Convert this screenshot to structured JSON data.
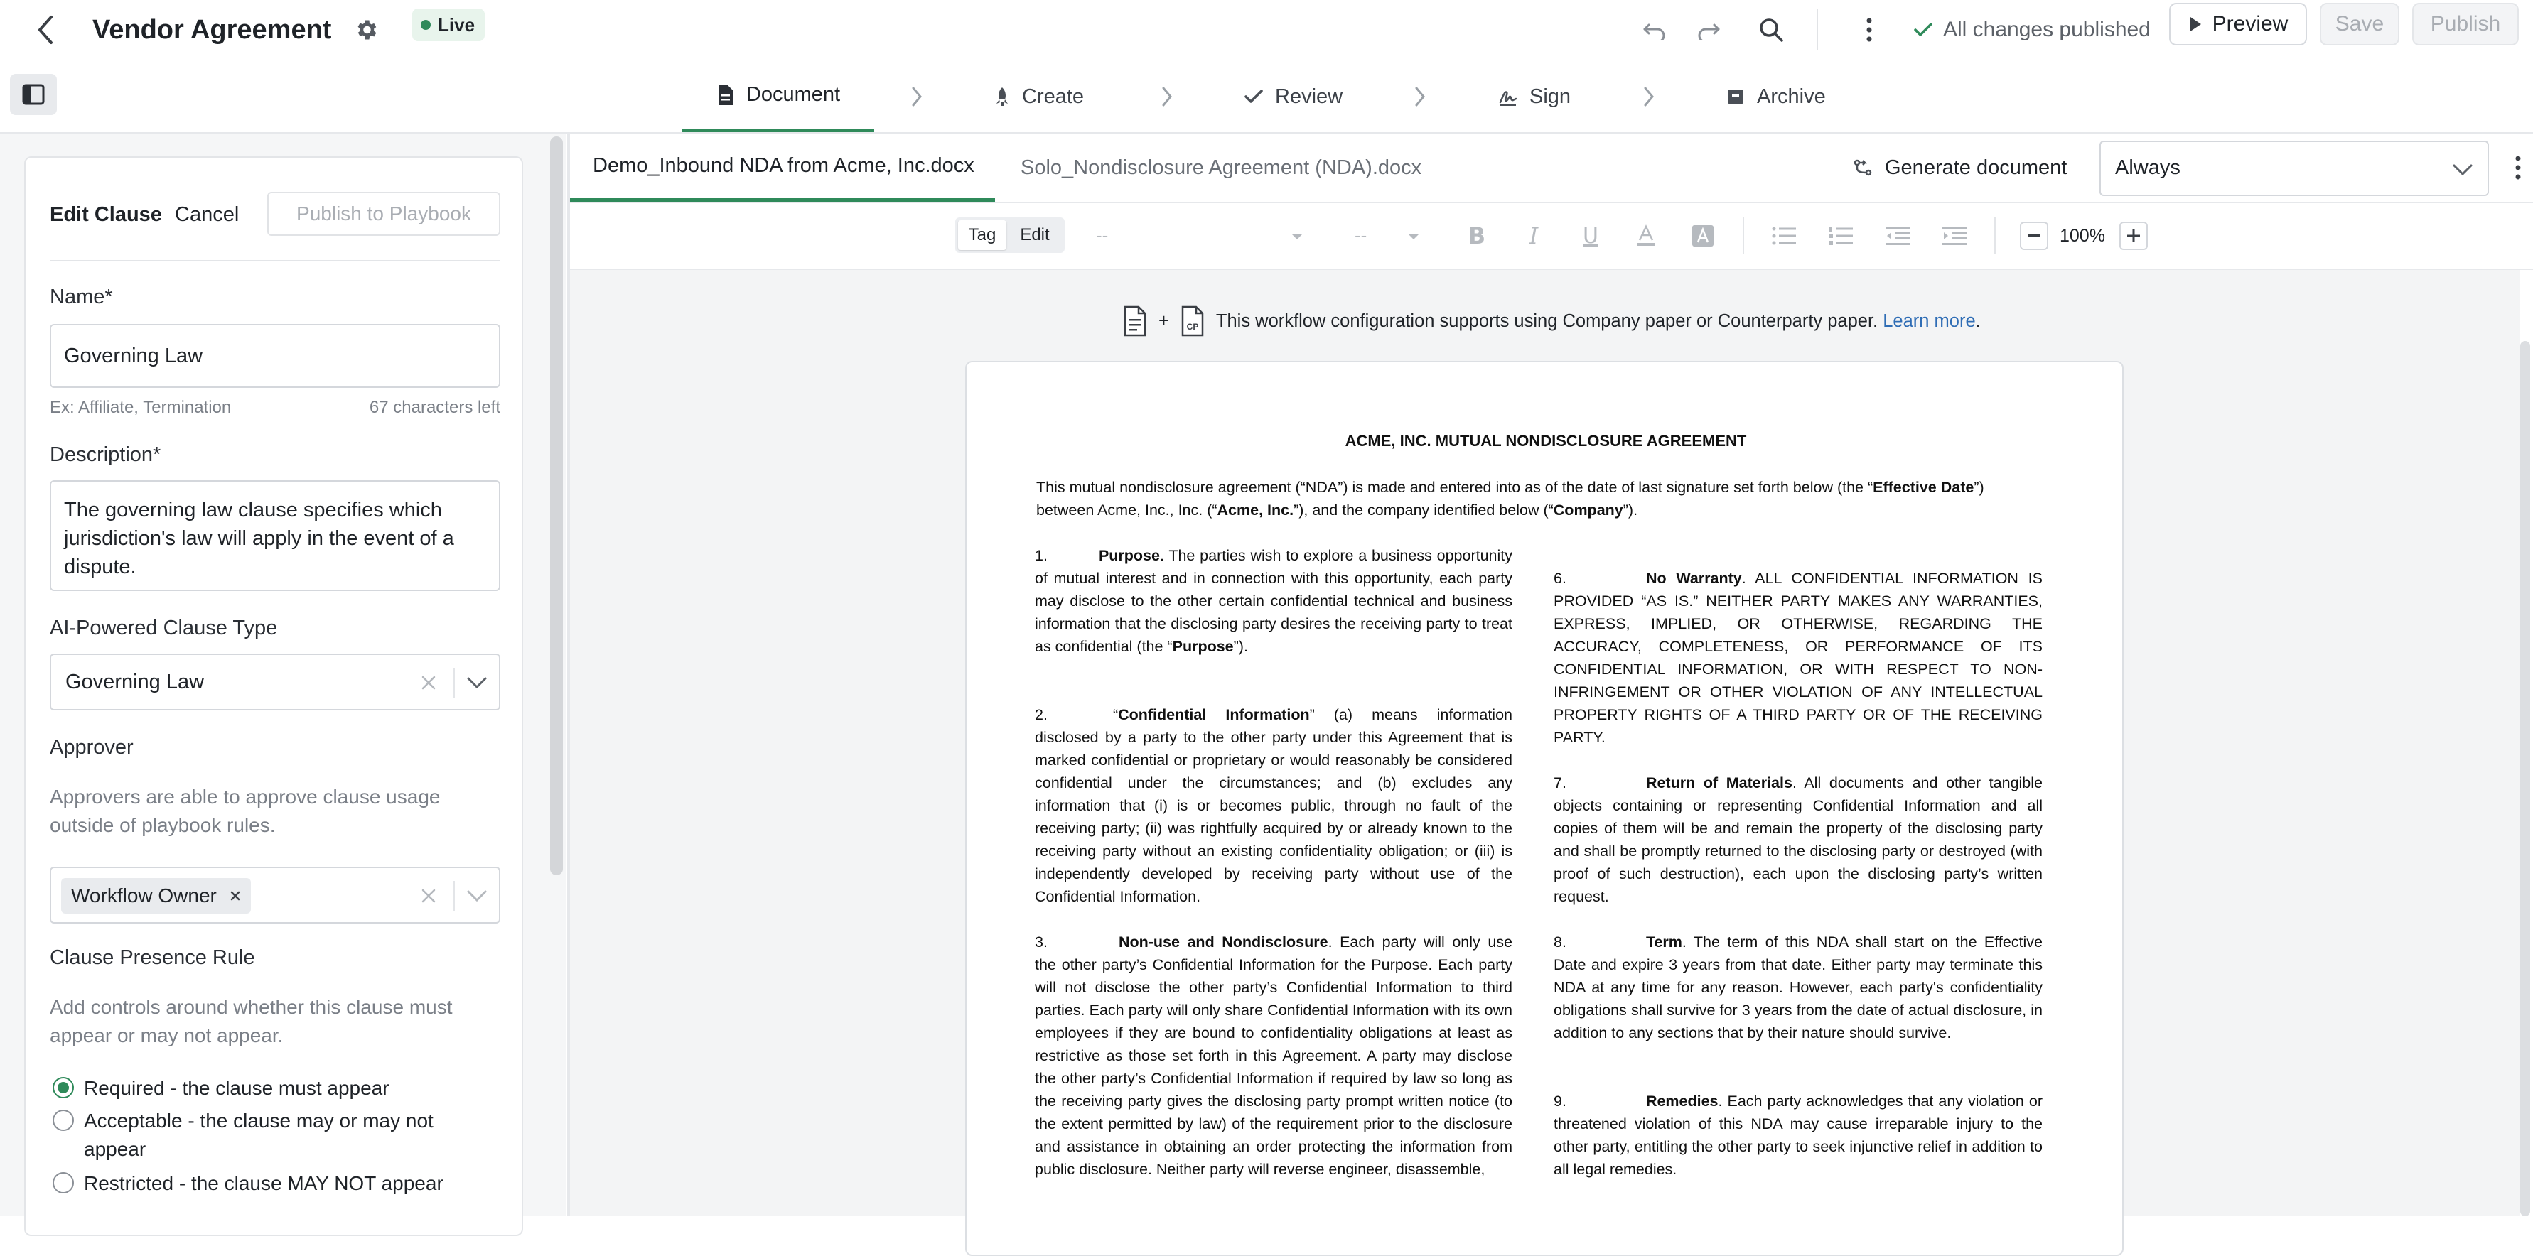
{
  "header": {
    "title": "Vendor Agreement",
    "status_badge": "Live",
    "publish_status": "All changes published",
    "preview_label": "Preview",
    "save_label": "Save",
    "publish_label": "Publish"
  },
  "steps": [
    {
      "label": "Document",
      "icon": "document-icon"
    },
    {
      "label": "Create",
      "icon": "rocket-icon"
    },
    {
      "label": "Review",
      "icon": "check-icon"
    },
    {
      "label": "Sign",
      "icon": "signature-icon"
    },
    {
      "label": "Archive",
      "icon": "archive-icon"
    }
  ],
  "clause_editor": {
    "title": "Edit Clause",
    "cancel_label": "Cancel",
    "publish_label": "Publish to Playbook",
    "name_label": "Name*",
    "name_value": "Governing Law",
    "name_hint": "Ex: Affiliate, Termination",
    "name_counter": "67 characters left",
    "description_label": "Description*",
    "description_value": "The governing law clause specifies which jurisdiction's law will apply in the event of a dispute.",
    "clause_type_label": "AI-Powered Clause Type",
    "clause_type_value": "Governing Law",
    "approver_label": "Approver",
    "approver_help": "Approvers are able to approve clause usage outside of playbook rules.",
    "approver_chip": "Workflow Owner",
    "presence_label": "Clause Presence Rule",
    "presence_help": "Add controls around whether this clause must appear or may not appear.",
    "presence_options": [
      {
        "label": "Required - the clause must appear",
        "selected": true
      },
      {
        "label": "Acceptable - the clause may or may not appear",
        "selected": false
      },
      {
        "label": "Restricted - the clause MAY NOT appear",
        "selected": false
      }
    ]
  },
  "file_tabs": [
    {
      "label": "Demo_Inbound NDA from Acme, Inc.docx",
      "active": true
    },
    {
      "label": "Solo_Nondisclosure Agreement (NDA).docx",
      "active": false
    }
  ],
  "generate_label": "Generate document",
  "generate_select": "Always",
  "toolbar": {
    "tag_label": "Tag",
    "edit_label": "Edit",
    "style_placeholder": "--",
    "size_placeholder": "--",
    "zoom": "100%"
  },
  "info_banner": {
    "plus": "+",
    "text": "This workflow configuration supports using Company paper or Counterparty paper.",
    "link": "Learn more",
    "period": "."
  },
  "document": {
    "title": "ACME, INC. MUTUAL NONDISCLOSURE AGREEMENT",
    "intro": {
      "t1": "This mutual nondisclosure agreement (“NDA”) is made and entered into as of the date of last signature set forth below (the “",
      "b1": "Effective Date",
      "t2": "”) between Acme, Inc., Inc. (“",
      "b2": "Acme, Inc.",
      "t3": "”), and the company identified below (“",
      "b3": "Company",
      "t4": "”)."
    },
    "sections_left": [
      {
        "num": "1.",
        "heading": "Purpose",
        "pre": "",
        "text": ".  The parties wish to explore a business opportunity of mutual interest and in connection with this opportunity, each party may disclose to the other certain confidential technical and business information that the disclosing party desires the receiving party to treat as confidential (the “",
        "bold2": "Purpose",
        "post": "”)."
      },
      {
        "num": "2.",
        "heading": "Confidential Information",
        "pre": "“",
        "text": "” (a) means information disclosed by a party to the other party under this Agreement that is marked confidential or proprietary or would reasonably be considered confidential under the circumstances; and (b) excludes any information that (i) is or becomes public, through no fault of the receiving party; (ii) was rightfully acquired by or already known to the receiving party without an existing confidentiality obligation; or (iii) is independently developed by receiving party without use of the Confidential Information.",
        "bold2": "",
        "post": ""
      },
      {
        "num": "3.",
        "heading": "Non-use and Nondisclosure",
        "pre": "",
        "text": ".  Each party will only use the other party’s Confidential Information for the Purpose.  Each party will not disclose the other party’s Confidential Information to third parties.  Each party will only share Confidential Information with its own employees if they are bound to confidentiality obligations at least as restrictive as those set forth in this Agreement.  A party may disclose the other party’s Confidential Information if required by law so long as the receiving party gives the disclosing party prompt written notice (to the extent permitted by law) of the requirement prior to the disclosure and assistance in obtaining an order protecting the information from public disclosure. Neither party will reverse engineer, disassemble,",
        "bold2": "",
        "post": ""
      }
    ],
    "sections_right": [
      {
        "num": "6.",
        "heading": "No Warranty",
        "text": ".  ALL CONFIDENTIAL INFORMATION IS PROVIDED “AS IS.”  NEITHER PARTY MAKES ANY WARRANTIES, EXPRESS, IMPLIED, OR OTHERWISE, REGARDING THE ACCURACY, COMPLETENESS, OR PERFORMANCE OF ITS CONFIDENTIAL INFORMATION, OR WITH RESPECT TO NON-INFRINGEMENT OR OTHER VIOLATION OF ANY INTELLECTUAL PROPERTY RIGHTS OF A THIRD PARTY OR OF THE RECEIVING PARTY."
      },
      {
        "num": "7.",
        "heading": "Return of Materials",
        "text": ".  All documents and other tangible objects containing or representing Confidential Information and all copies of them will be and remain the property of the disclosing party and shall be promptly returned to the disclosing party or destroyed (with proof of such destruction), each upon the disclosing party’s written request."
      },
      {
        "num": "8.",
        "heading": "Term",
        "text": ".  The term of this NDA shall start on the Effective Date and expire 3 years from that date. Either party may terminate this NDA at any time for any reason. However, each party's confidentiality obligations shall survive for 3 years from the date of actual disclosure, in addition to any sections that by their nature should survive."
      },
      {
        "num": "9.",
        "heading": "Remedies",
        "text": ".  Each party acknowledges that any violation or threatened violation of this NDA may cause irreparable injury to the other party, entitling the other party to seek injunctive relief in addition to all legal remedies."
      }
    ]
  }
}
